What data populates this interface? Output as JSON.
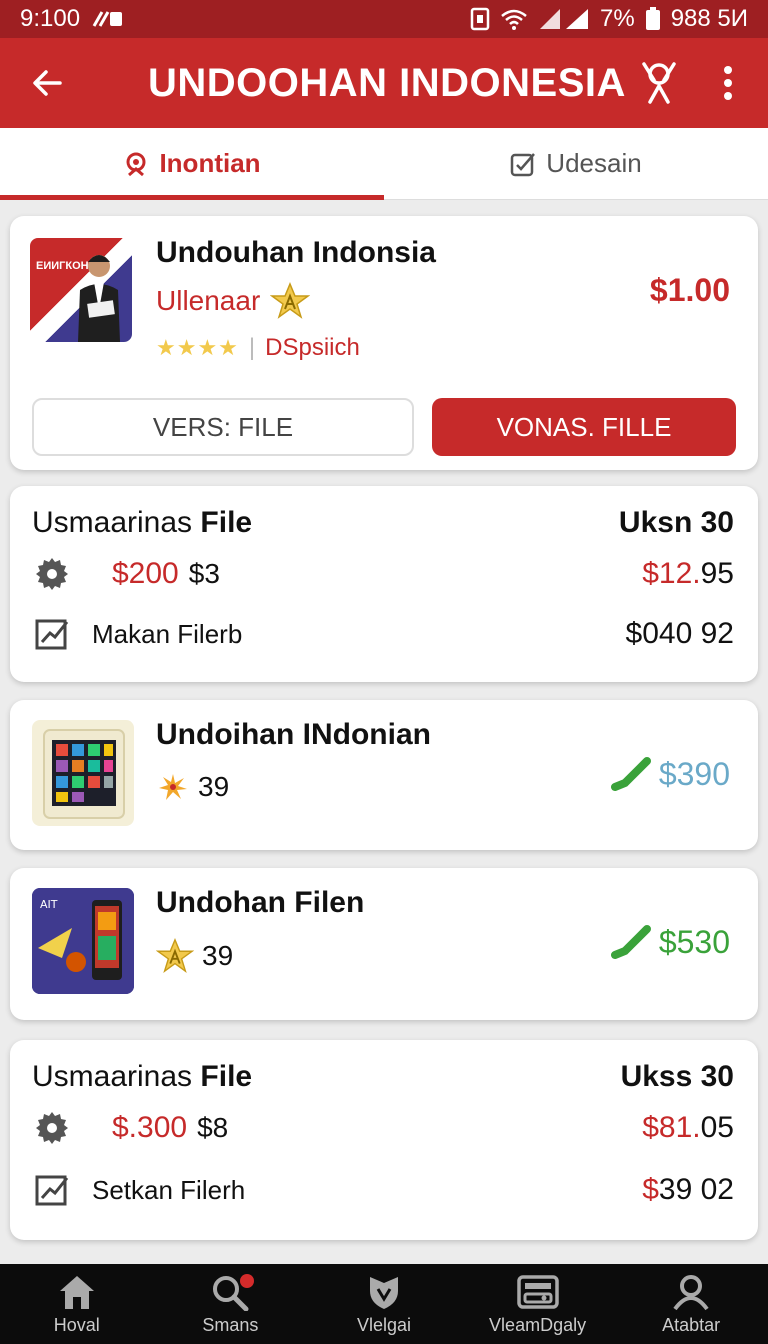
{
  "status": {
    "time": "9:100",
    "battery": "7%",
    "right_text": "988 5И"
  },
  "appbar": {
    "title": "UNDOOHAN INDONESIA"
  },
  "tabs": [
    {
      "label": "Inontian",
      "active": true,
      "icon": "badge-icon"
    },
    {
      "label": "Udesain",
      "active": false,
      "icon": "checkbox-icon"
    }
  ],
  "featured": {
    "thumb_text": "ЕИИГКОН",
    "title": "Undouhan Indonsia",
    "subtitle": "Ullenaar",
    "stars": "★★★★",
    "detail": "DSpsiich",
    "price": "$1.00",
    "button_outline": "VERS: FILE",
    "button_filled": "VONAS. FILLE"
  },
  "summary1": {
    "title_plain": "Usmaarinas",
    "title_bold": "File",
    "right": "Uksn 30",
    "row1": {
      "red": "$200",
      "black": "$3",
      "amt_red": "$12.",
      "amt_black": "95"
    },
    "row2": {
      "label": "Makan  Filerb",
      "amt": "$040 92"
    }
  },
  "apps": [
    {
      "title": "Undoihan INdonian",
      "count": "39",
      "price": "$390",
      "price_color": "#6aa9c8"
    },
    {
      "title": "Undohan Filen",
      "count": "39",
      "price": "$530",
      "price_color": "#3aa23a"
    }
  ],
  "summary2": {
    "title_plain": "Usmaarinas",
    "title_bold": "File",
    "right": "Ukss 30",
    "row1": {
      "red": "$.300",
      "black": "$8",
      "amt_red": "$81.",
      "amt_black": "05"
    },
    "row2": {
      "label": "Setkan  Filerh",
      "amt_red": "$",
      "amt_black": "39 02"
    }
  },
  "nav": [
    {
      "label": "Hoval",
      "icon": "home-icon"
    },
    {
      "label": "Smans",
      "icon": "search-icon"
    },
    {
      "label": "Vlelgai",
      "icon": "shield-icon"
    },
    {
      "label": "VleamDgaly",
      "icon": "wallet-icon"
    },
    {
      "label": "Atabtar",
      "icon": "profile-icon"
    }
  ],
  "colors": {
    "primary": "#c62a2a",
    "status_bar": "#9e1f22",
    "star": "#f2c94c",
    "price_green": "#3aa23a",
    "price_blue": "#6aa9c8"
  }
}
